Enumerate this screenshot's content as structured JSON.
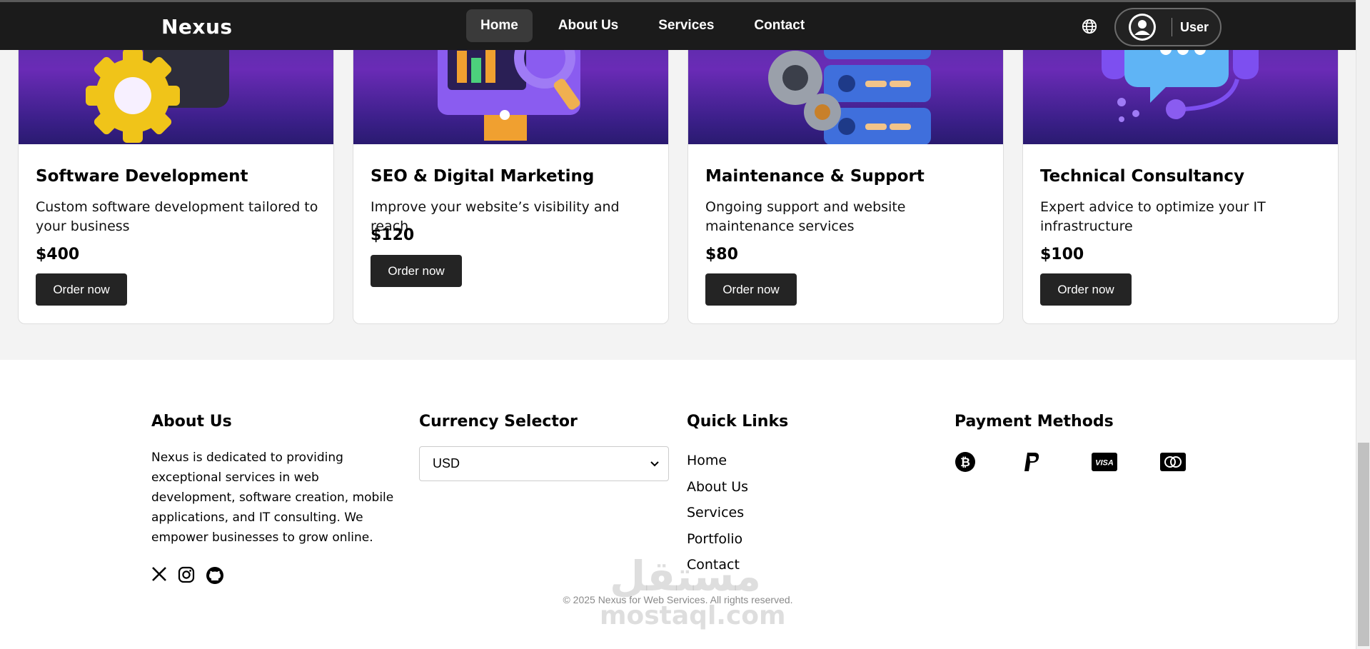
{
  "nav": {
    "logo": "Nexus",
    "links": [
      {
        "label": "Home",
        "active": true
      },
      {
        "label": "About Us"
      },
      {
        "label": "Services"
      },
      {
        "label": "Contact"
      }
    ],
    "globe_icon": "globe-icon",
    "user_label": "User"
  },
  "services": [
    {
      "title": "Software Development",
      "description": "Custom software development tailored to your business",
      "price": "$400",
      "button": "Order now",
      "illustration": "gear-window-illustration"
    },
    {
      "title": "SEO & Digital Marketing",
      "description": "Improve your website’s visibility and reach",
      "price": "$120",
      "button": "Order now",
      "illustration": "monitor-magnifier-illustration"
    },
    {
      "title": "Maintenance & Support",
      "description": "Ongoing support and website maintenance services",
      "price": "$80",
      "button": "Order now",
      "illustration": "server-gears-illustration"
    },
    {
      "title": "Technical Consultancy",
      "description": "Expert advice to optimize your IT infrastructure",
      "price": "$100",
      "button": "Order now",
      "illustration": "headset-chat-illustration"
    }
  ],
  "footer": {
    "about": {
      "heading": "About Us",
      "text": "Nexus is dedicated to providing exceptional services in web development, software creation, mobile applications, and IT consulting. We empower businesses to grow online.",
      "social_icons": [
        "x-icon",
        "instagram-icon",
        "github-icon"
      ]
    },
    "currency": {
      "heading": "Currency Selector",
      "selected": "USD"
    },
    "quick_links": {
      "heading": "Quick Links",
      "items": [
        "Home",
        "About Us",
        "Services",
        "Portfolio",
        "Contact"
      ]
    },
    "payment": {
      "heading": "Payment Methods",
      "icons": [
        "bitcoin-icon",
        "paypal-icon",
        "visa-icon",
        "mastercard-icon"
      ]
    },
    "copyright": "© 2025 Nexus for Web Services. All rights reserved."
  },
  "watermark": {
    "arabic": "مستقل",
    "latin": "mostaql.com"
  },
  "colors": {
    "nav_bg": "#1b1b1b",
    "button_bg": "#242424",
    "card_image_gradient_top": "#5a2ea8"
  }
}
